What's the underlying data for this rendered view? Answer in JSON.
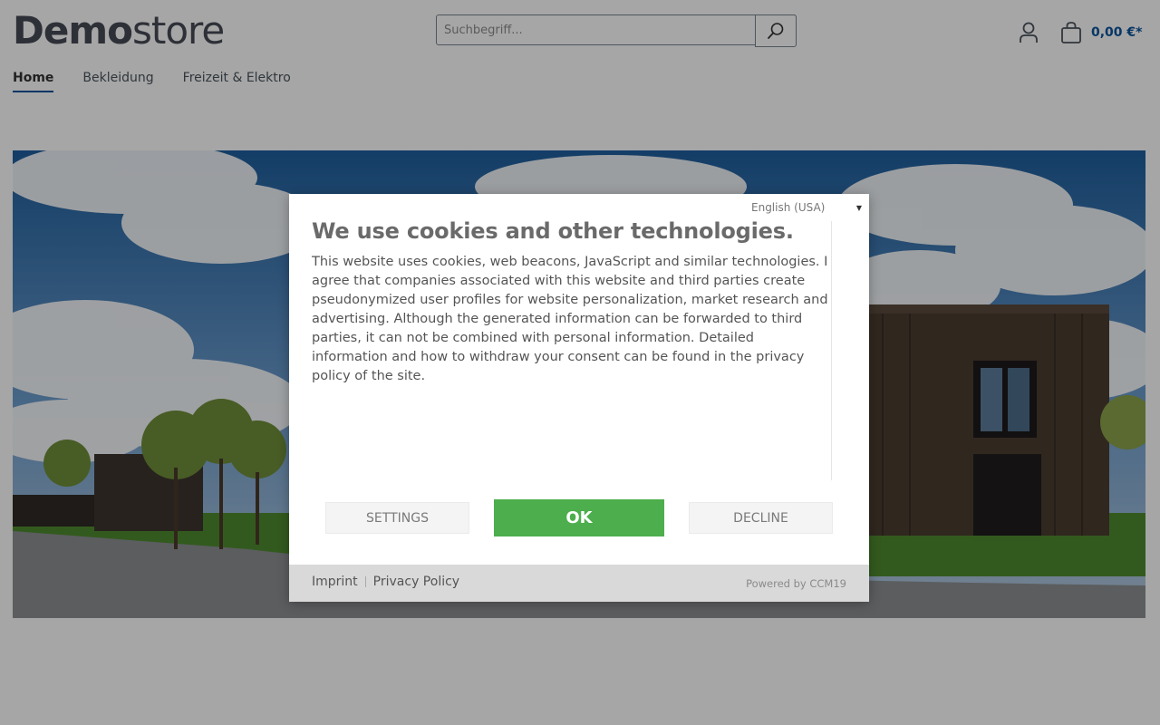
{
  "header": {
    "logo_bold": "Demo",
    "logo_light": "store",
    "search_placeholder": "Suchbegriff...",
    "cart_total": "0,00 €*",
    "icons": {
      "search": "search-icon",
      "account": "user-icon",
      "cart": "shopping-bag-icon"
    }
  },
  "nav": {
    "items": [
      {
        "label": "Home",
        "active": true
      },
      {
        "label": "Bekleidung",
        "active": false
      },
      {
        "label": "Freizeit & Elektro",
        "active": false
      }
    ]
  },
  "cookie": {
    "language": "English (USA)",
    "title": "We use cookies and other technologies.",
    "text": "This website uses cookies, web beacons, JavaScript and similar technologies. I agree that companies associated with this website and third parties create pseudonymized user profiles for website personalization, market research and advertising. Although the generated information can be forwarded to third parties, it can not be combined with personal information. Detailed information and how to withdraw your consent can be found in the privacy policy of the site.",
    "settings_label": "SETTINGS",
    "ok_label": "OK",
    "decline_label": "DECLINE",
    "imprint_label": "Imprint",
    "privacy_label": "Privacy Policy",
    "powered_by": "Powered by CCM19"
  },
  "colors": {
    "accent": "#0b539b",
    "ok_button": "#4cae4c",
    "overlay": "rgba(0,0,0,0.35)"
  }
}
